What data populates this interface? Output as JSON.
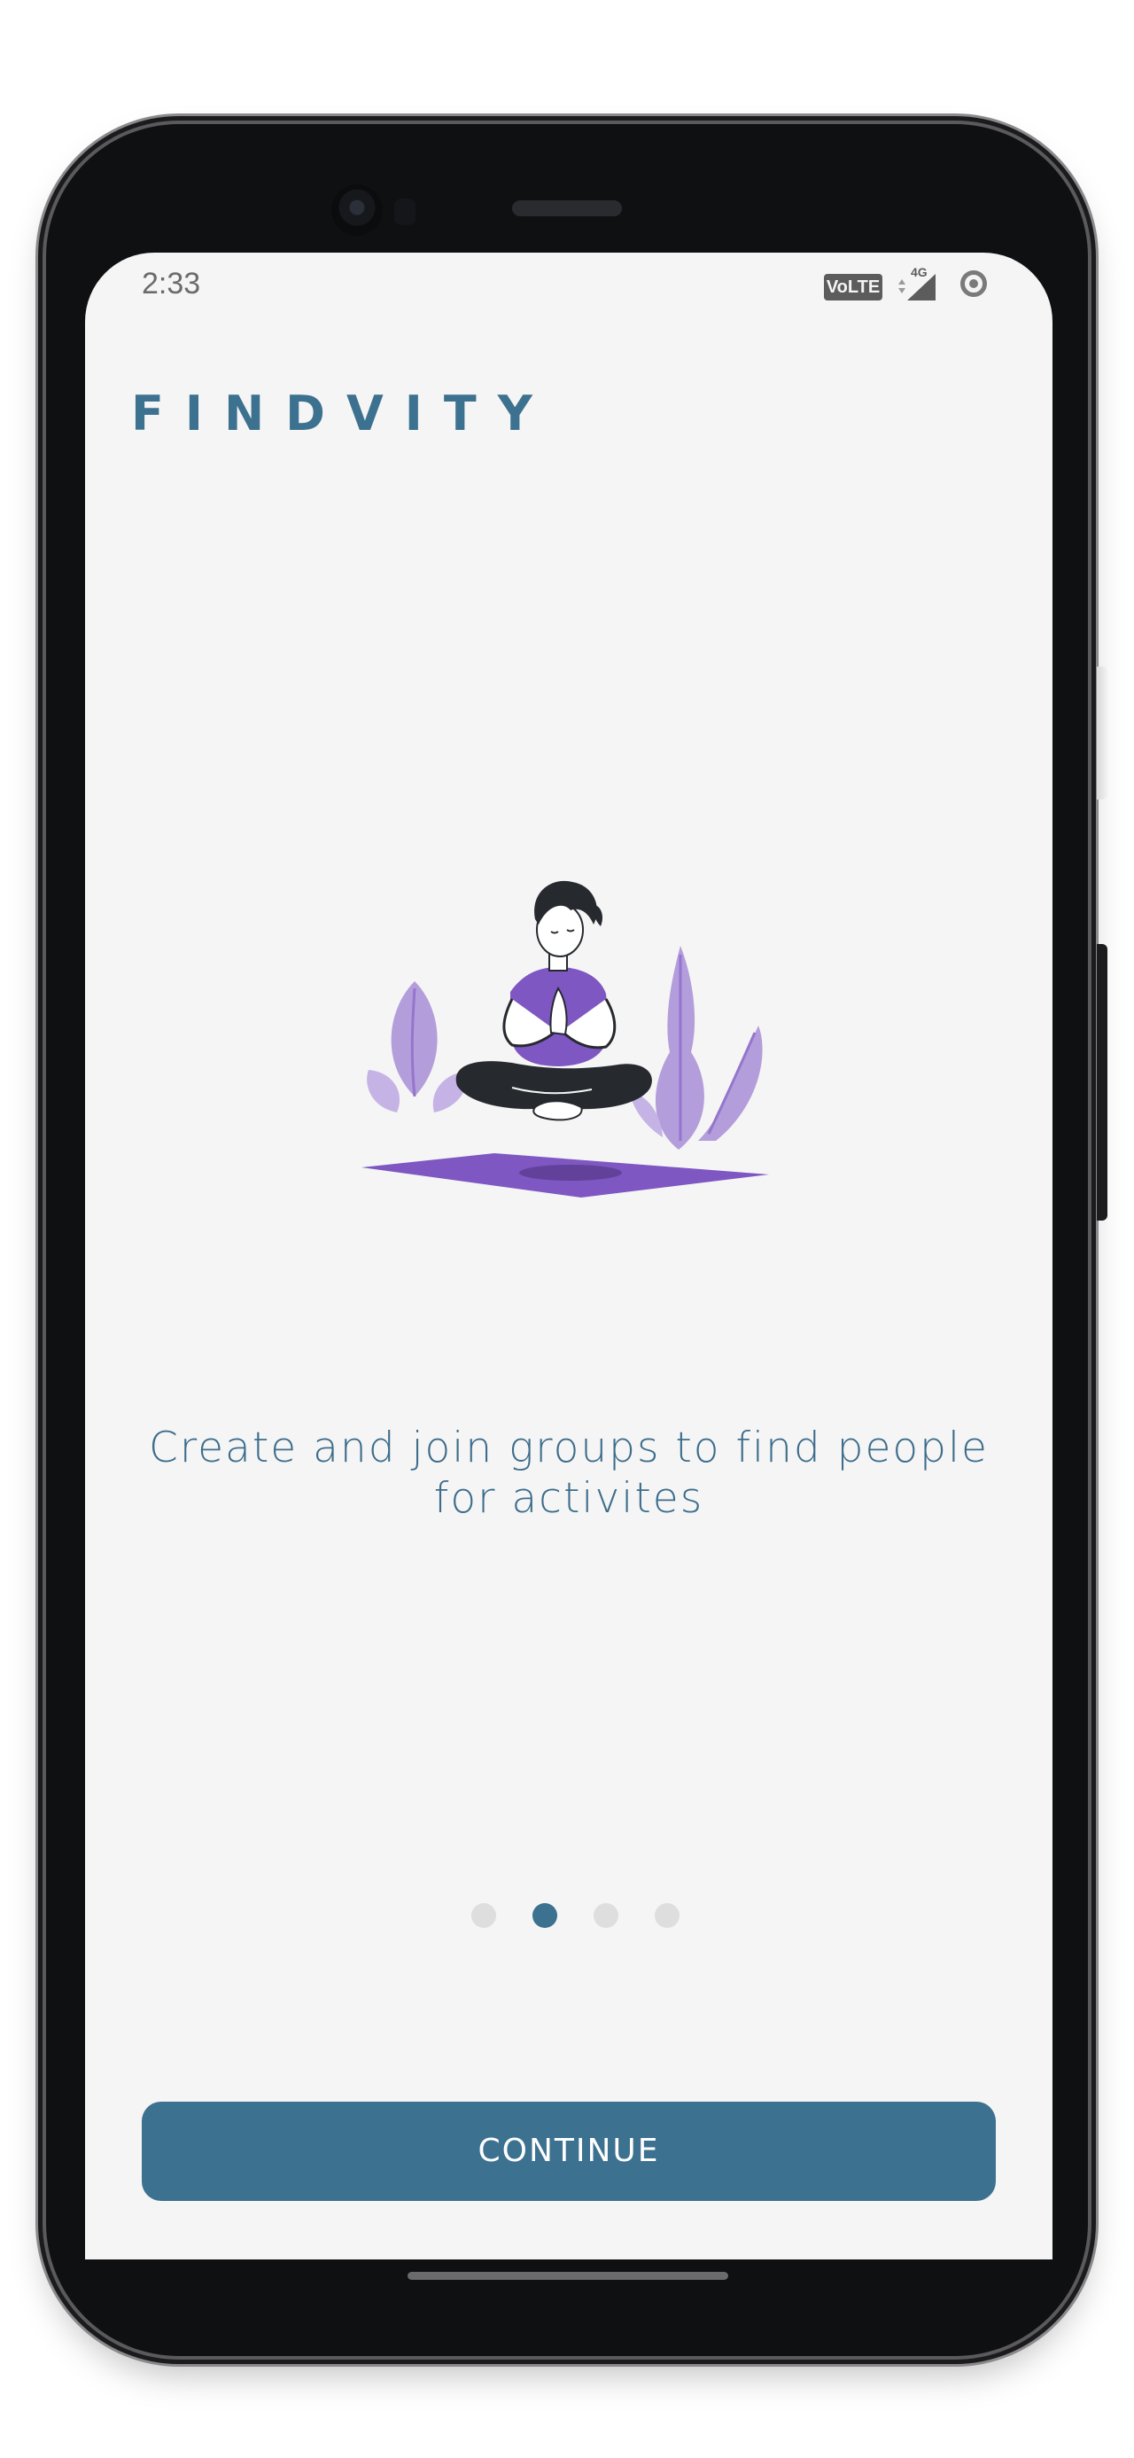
{
  "status_bar": {
    "time": "2:33",
    "volte_badge": "VoLTE",
    "network_label": "4G"
  },
  "app": {
    "logo_text": "FINDVITY"
  },
  "onboarding": {
    "caption": "Create and join groups to find people for activites",
    "pager": {
      "total_pages": 4,
      "active_page": 2
    },
    "continue_label": "CONTINUE"
  },
  "colors": {
    "brand": "#3d7190",
    "screen_background": "#f5f5f5",
    "inactive_dot": "#dedede",
    "illustration_purple": "#7e57c2",
    "illustration_lavender": "#b39ddb"
  },
  "icons": {
    "signal": "cell-signal-icon",
    "record": "screen-record-icon",
    "illustration": "meditating-person-illustration"
  }
}
